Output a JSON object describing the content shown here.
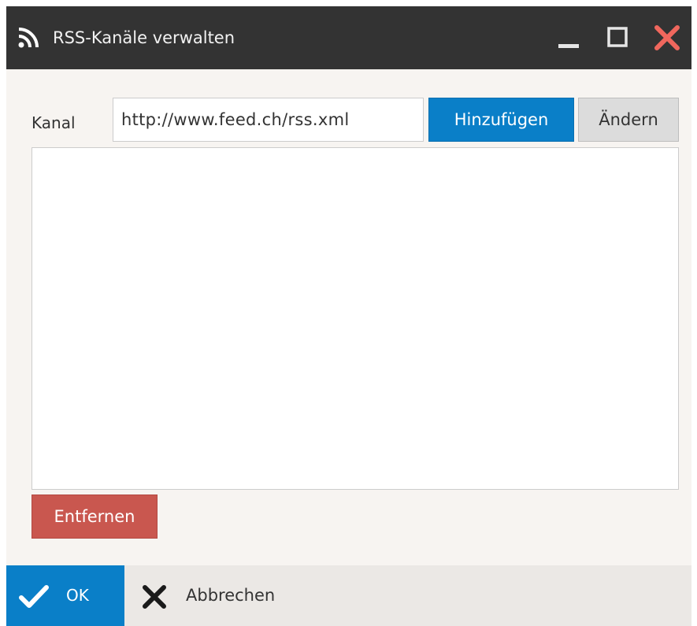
{
  "window": {
    "title": "RSS-Kanäle verwalten",
    "icons": {
      "title": "rss-icon",
      "minimize": "minimize-icon",
      "maximize": "maximize-icon",
      "close": "close-icon"
    },
    "colors": {
      "titlebar": "#333333",
      "close": "#f0675d",
      "background": "#f7f4f1"
    }
  },
  "form": {
    "channel_label": "Kanal",
    "channel_value": "http://www.feed.ch/rss.xml",
    "add_label": "Hinzufügen",
    "change_label": "Ändern",
    "remove_label": "Entfernen",
    "channels": []
  },
  "footer": {
    "ok_label": "OK",
    "cancel_label": "Abbrechen",
    "icons": {
      "ok": "checkmark-icon",
      "cancel": "x-icon"
    }
  },
  "colors": {
    "primary": "#0a7fc8",
    "danger": "#c9574f",
    "neutral": "#dcdcdc"
  }
}
